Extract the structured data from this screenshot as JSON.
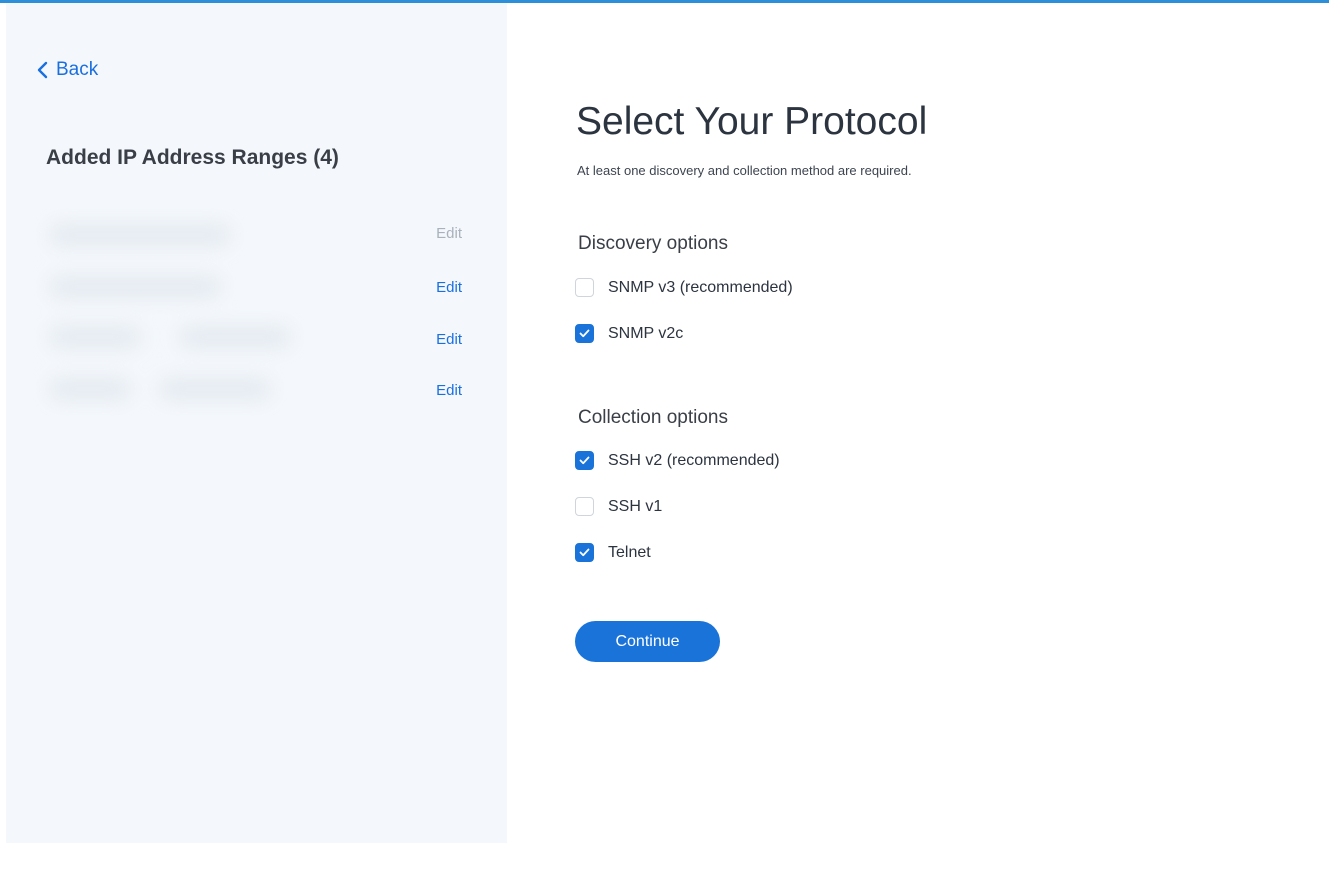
{
  "sidebar": {
    "back_label": "Back",
    "title": "Added IP Address Ranges (4)",
    "ranges": [
      {
        "edit_label": "Edit",
        "edit_enabled": false
      },
      {
        "edit_label": "Edit",
        "edit_enabled": true
      },
      {
        "edit_label": "Edit",
        "edit_enabled": true
      },
      {
        "edit_label": "Edit",
        "edit_enabled": true
      }
    ]
  },
  "main": {
    "title": "Select Your Protocol",
    "subtitle": "At least one discovery and collection method are required.",
    "discovery": {
      "heading": "Discovery options",
      "options": [
        {
          "label": "SNMP v3 (recommended)",
          "checked": false
        },
        {
          "label": "SNMP v2c",
          "checked": true
        }
      ]
    },
    "collection": {
      "heading": "Collection options",
      "options": [
        {
          "label": "SSH v2 (recommended)",
          "checked": true
        },
        {
          "label": "SSH v1",
          "checked": false
        },
        {
          "label": "Telnet",
          "checked": true
        }
      ]
    },
    "continue_label": "Continue"
  },
  "colors": {
    "accent": "#1a73d9",
    "link": "#1a6fe0",
    "sidebar_bg": "#f4f8fc",
    "top_bar": "#2d8fd8"
  }
}
